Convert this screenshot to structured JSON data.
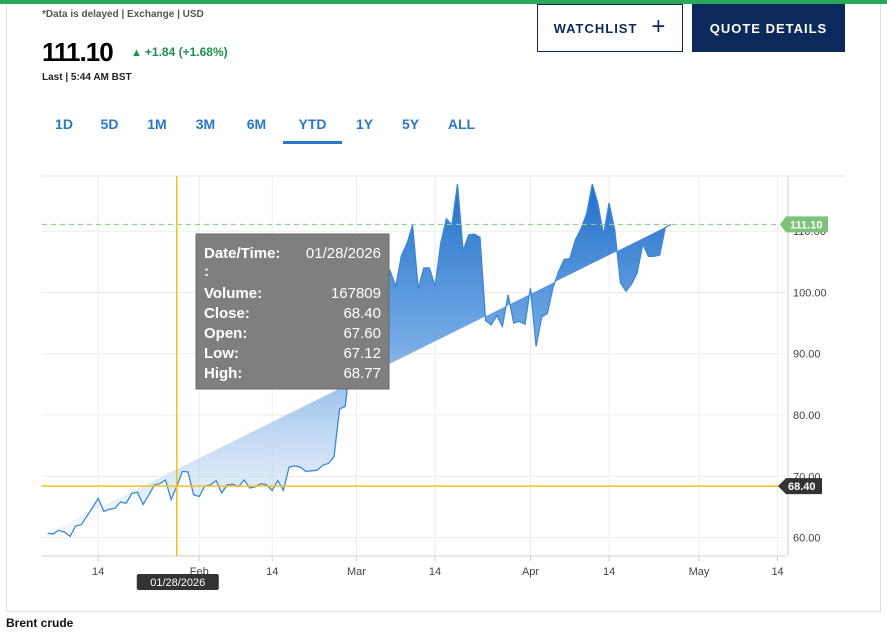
{
  "header": {
    "note": "*Data is delayed | Exchange | USD",
    "price": "111.10",
    "change": "+1.84 (+1.68%)",
    "change_arrow": "▲",
    "last": "Last | 5:44 AM BST",
    "watchlist_label": "WATCHLIST",
    "watchlist_icon": "plus-icon",
    "quote_label": "QUOTE DETAILS"
  },
  "colors": {
    "accent": "#2a78c5",
    "navy": "#0b2a5b",
    "positive": "#1e8f4e",
    "crosshair": "#f0c419",
    "current_tag": "#7dc27a"
  },
  "tabs": [
    {
      "label": "1D",
      "active": false
    },
    {
      "label": "5D",
      "active": false
    },
    {
      "label": "1M",
      "active": false
    },
    {
      "label": "3M",
      "active": false
    },
    {
      "label": "6M",
      "active": false
    },
    {
      "label": "YTD",
      "active": true
    },
    {
      "label": "1Y",
      "active": false
    },
    {
      "label": "5Y",
      "active": false
    },
    {
      "label": "ALL",
      "active": false
    }
  ],
  "tooltip": {
    "date_label": "Date/Time:",
    "date_value": "01/28/2026",
    "colon": ":",
    "rows": [
      {
        "label": "Volume:",
        "value": "167809"
      },
      {
        "label": "Close:",
        "value": "68.40"
      },
      {
        "label": "Open:",
        "value": "67.60"
      },
      {
        "label": "Low:",
        "value": "67.12"
      },
      {
        "label": "High:",
        "value": "68.77"
      }
    ]
  },
  "crosshair_date_tag": "01/28/2026",
  "current_price_tag": "111.10",
  "crosshair_price_tag": "68.40",
  "footer": {
    "title": "Brent crude"
  },
  "chart_data": {
    "type": "area",
    "ylim": [
      57,
      119
    ],
    "y_ticks": [
      "60.00",
      "70.00",
      "80.00",
      "90.00",
      "100.00",
      "110.00"
    ],
    "y_tick_values": [
      60,
      70,
      80,
      90,
      100,
      110
    ],
    "x_ticks": [
      "14",
      "Feb",
      "14",
      "Mar",
      "14",
      "Apr",
      "14",
      "May",
      "14"
    ],
    "x_tick_days": [
      14,
      32,
      45,
      60,
      74,
      91,
      105,
      121,
      135
    ],
    "current_value": 111.1,
    "crosshair": {
      "day": 28,
      "value": 68.4
    },
    "x_days": [
      5,
      6,
      7,
      8,
      9,
      10,
      11,
      12,
      13,
      14,
      15,
      16,
      17,
      18,
      19,
      20,
      21,
      22,
      23,
      24,
      25,
      26,
      27,
      28,
      29,
      30,
      31,
      32,
      33,
      34,
      35,
      36,
      37,
      38,
      39,
      40,
      41,
      42,
      43,
      44,
      45,
      46,
      47,
      48,
      49,
      50,
      51,
      52,
      53,
      54,
      55,
      56,
      57,
      58,
      59,
      60,
      61,
      62,
      63,
      64,
      65,
      66,
      67,
      68,
      69,
      70,
      71,
      72,
      73,
      74,
      75,
      76,
      77,
      78,
      79,
      80,
      81,
      82,
      83,
      84,
      85,
      86,
      87,
      88,
      89,
      90,
      91,
      92,
      93,
      94,
      95,
      96,
      97,
      98,
      99,
      100,
      101,
      102,
      103,
      104,
      105,
      106,
      107,
      108,
      109,
      110,
      111,
      112,
      113,
      114,
      115,
      116,
      117,
      118,
      119,
      120,
      121,
      122,
      123,
      124,
      125,
      126,
      127,
      128,
      129,
      130,
      131,
      132,
      133,
      134,
      135,
      136
    ],
    "values": [
      60.7,
      60.6,
      61.2,
      60.9,
      60.2,
      61.9,
      62.1,
      63.5,
      64.9,
      66.4,
      64.3,
      64.6,
      64.8,
      65.8,
      65.6,
      67.2,
      67.4,
      65.4,
      66.9,
      68.6,
      68.8,
      69.4,
      66.2,
      68.4,
      70.8,
      70.7,
      67.0,
      66.7,
      68.4,
      68.6,
      69.3,
      67.3,
      68.6,
      68.7,
      68.3,
      69.4,
      68.1,
      68.3,
      68.8,
      68.6,
      67.7,
      69.3,
      67.7,
      71.5,
      71.7,
      71.5,
      70.8,
      70.9,
      71.0,
      71.8,
      72.1,
      73.2,
      81.0,
      81.4,
      89.4,
      94.0,
      99.0,
      87.8,
      93.0,
      96.8,
      101.0,
      103.5,
      101.0,
      106.0,
      108.0,
      111.0,
      100.6,
      104.0,
      104.0,
      101.0,
      108.0,
      112.0,
      111.0,
      117.7,
      106.8,
      109.4,
      109.5,
      109.0,
      95.4,
      94.7,
      96.2,
      94.5,
      99.6,
      95.0,
      95.3,
      94.8,
      100.7,
      91.2,
      96.0,
      96.6,
      100.8,
      103.4,
      105.4,
      105.5,
      108.6,
      110.4,
      112.9,
      117.7,
      114.5,
      109.4,
      114.6,
      110.2,
      101.6,
      100.2,
      101.4,
      103.2,
      107.9,
      105.9,
      105.9,
      106.1,
      110.6,
      111.1
    ]
  }
}
